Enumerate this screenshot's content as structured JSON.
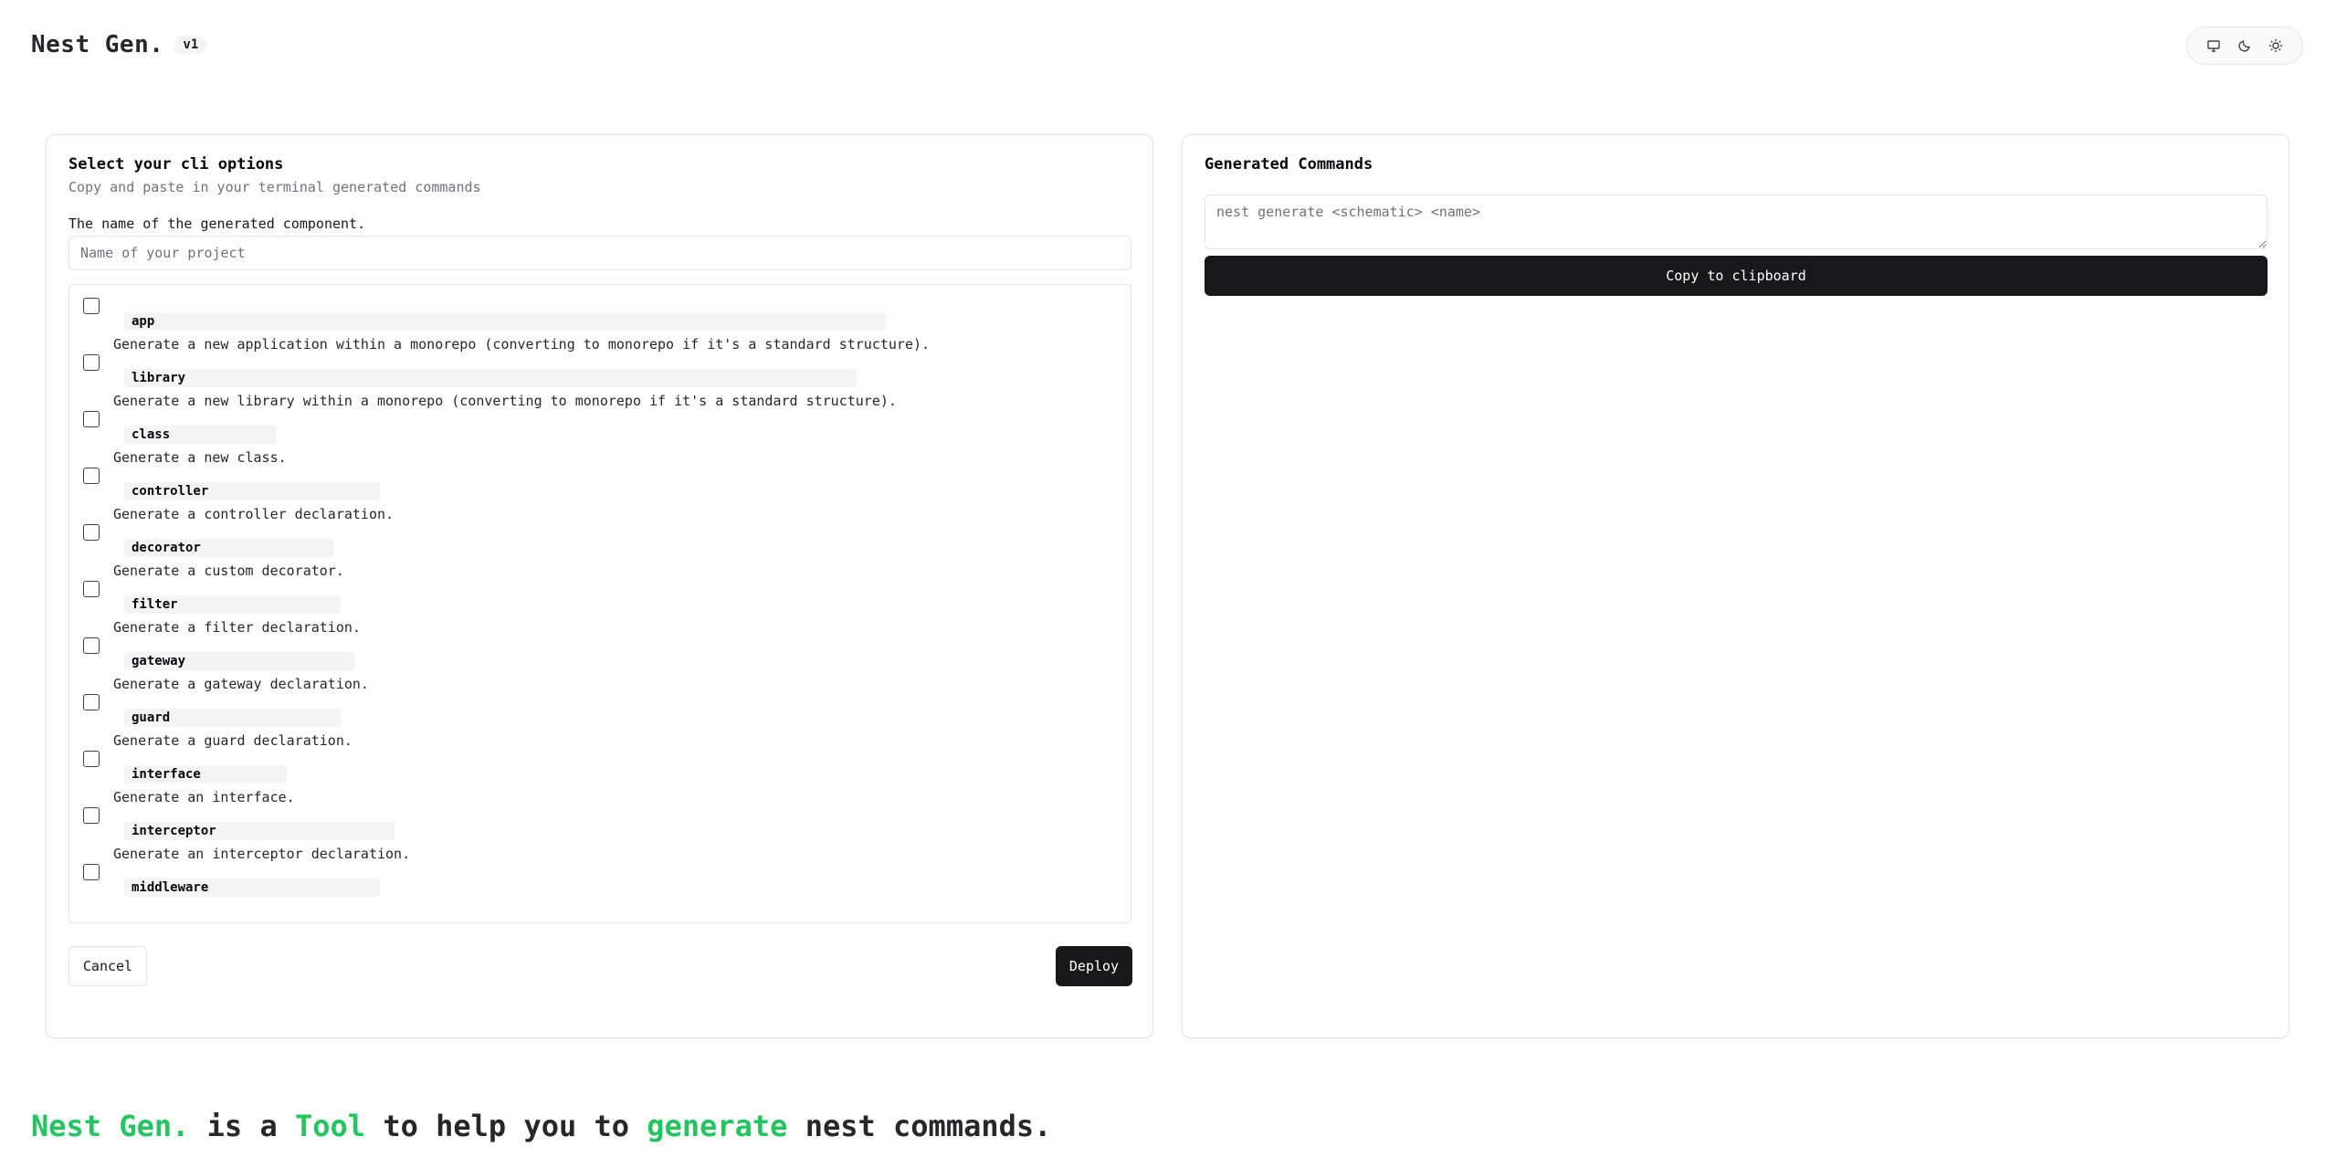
{
  "header": {
    "brand": "Nest Gen.",
    "version": "v1"
  },
  "theme_switch": {
    "icons": [
      "monitor-icon",
      "moon-icon",
      "sun-icon"
    ]
  },
  "options_card": {
    "title": "Select your cli options",
    "subtitle": "Copy and paste in your terminal generated commands",
    "name_label": "The name of the generated component.",
    "name_placeholder": "Name of your project",
    "name_value": "",
    "options": [
      {
        "name": "app",
        "description": "Generate a new application within a monorepo (converting to monorepo if it's a standard structure).",
        "checked": false
      },
      {
        "name": "library",
        "description": "Generate a new library within a monorepo (converting to monorepo if it's a standard structure).",
        "checked": false
      },
      {
        "name": "class",
        "description": "Generate a new class.",
        "checked": false
      },
      {
        "name": "controller",
        "description": "Generate a controller declaration.",
        "checked": false
      },
      {
        "name": "decorator",
        "description": "Generate a custom decorator.",
        "checked": false
      },
      {
        "name": "filter",
        "description": "Generate a filter declaration.",
        "checked": false
      },
      {
        "name": "gateway",
        "description": "Generate a gateway declaration.",
        "checked": false
      },
      {
        "name": "guard",
        "description": "Generate a guard declaration.",
        "checked": false
      },
      {
        "name": "interface",
        "description": "Generate an interface.",
        "checked": false
      },
      {
        "name": "interceptor",
        "description": "Generate an interceptor declaration.",
        "checked": false
      },
      {
        "name": "middleware",
        "description": "",
        "checked": false
      }
    ],
    "cancel_label": "Cancel",
    "deploy_label": "Deploy"
  },
  "commands_card": {
    "title": "Generated Commands",
    "placeholder": "nest generate <schematic> <name>",
    "value": "",
    "copy_label": "Copy to clipboard"
  },
  "footer": {
    "brand": "Nest Gen.",
    "t1": " is a ",
    "tool": "Tool",
    "t2": " to help you to ",
    "generate": "generate",
    "t3": " nest commands."
  },
  "colors": {
    "accent_green": "#22c55e",
    "primary_dark": "#18181b",
    "border": "#e4e4e7",
    "muted_text": "#71717a"
  }
}
